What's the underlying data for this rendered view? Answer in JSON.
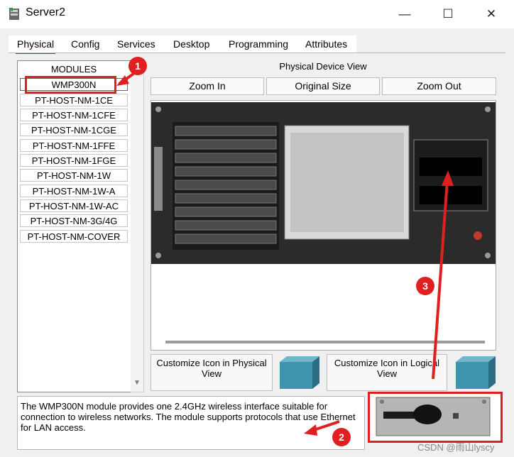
{
  "window": {
    "title": "Server2",
    "minimize_glyph": "—",
    "maximize_glyph": "☐",
    "close_glyph": "✕"
  },
  "tabs": [
    {
      "label": "Physical",
      "active": true
    },
    {
      "label": "Config",
      "active": false
    },
    {
      "label": "Services",
      "active": false
    },
    {
      "label": "Desktop",
      "active": false
    },
    {
      "label": "Programming",
      "active": false
    },
    {
      "label": "Attributes",
      "active": false
    }
  ],
  "modules": {
    "header": "MODULES",
    "items": [
      "WMP300N",
      "PT-HOST-NM-1CE",
      "PT-HOST-NM-1CFE",
      "PT-HOST-NM-1CGE",
      "PT-HOST-NM-1FFE",
      "PT-HOST-NM-1FGE",
      "PT-HOST-NM-1W",
      "PT-HOST-NM-1W-A",
      "PT-HOST-NM-1W-AC",
      "PT-HOST-NM-3G/4G",
      "PT-HOST-NM-COVER"
    ],
    "selected": "WMP300N"
  },
  "device_view": {
    "title": "Physical Device View",
    "zoom_in": "Zoom In",
    "original_size": "Original Size",
    "zoom_out": "Zoom Out"
  },
  "customize": {
    "physical": "Customize Icon in Physical View",
    "logical": "Customize Icon in Logical View"
  },
  "description": "The WMP300N module provides one 2.4GHz wireless interface suitable for connection to wireless networks. The module supports protocols that use Ethernet for LAN access.",
  "annotations": {
    "badge1": "1",
    "badge2": "2",
    "badge3": "3"
  },
  "watermark": "CSDN @雨山lyscy",
  "colors": {
    "annotation_red": "#e02020",
    "tab_accent": "#1f5fbf",
    "cube": "#3f93ad"
  },
  "icons": {
    "app": "server-icon",
    "scroll_down": "triangle-down-icon"
  }
}
